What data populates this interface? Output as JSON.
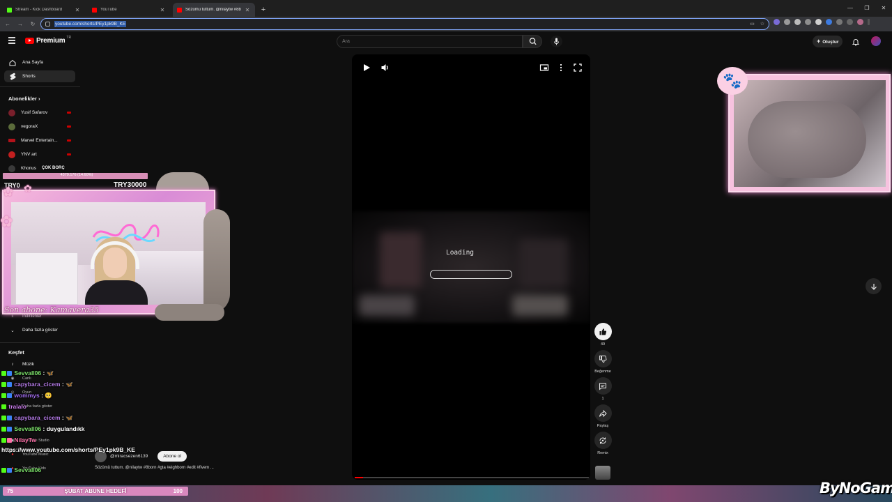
{
  "browser": {
    "tabs": [
      {
        "title": "Stream - Kick Dashboard",
        "favicon_color": "#53fc18"
      },
      {
        "title": "YouTube",
        "favicon_color": "#ff0000"
      },
      {
        "title": "Sözümü tuttum. @nilaytw #8b",
        "favicon_color": "#ff0000"
      }
    ],
    "url": "youtube.com/shorts/PEy1pk9B_KE"
  },
  "youtube": {
    "logo": "Premium",
    "region": "TR",
    "search_placeholder": "Ara",
    "create_label": "Oluştur",
    "sidebar": {
      "home": "Ana Sayfa",
      "shorts": "Shorts",
      "subscriptions_title": "Abonelikler",
      "subscriptions": [
        {
          "name": "Yusif Safarov",
          "color": "#7a1f2b"
        },
        {
          "name": "vegoraX",
          "color": "#5b6b3a"
        },
        {
          "name": "Marvel Entertain...",
          "color": "#b3121a"
        },
        {
          "name": "YNV art",
          "color": "#c21f1f"
        },
        {
          "name": "Khonus",
          "color": "#3a3a3a"
        }
      ],
      "downloads": "İndirilenler",
      "show_more": "Daha fazla göster",
      "explore_title": "Keşfet",
      "explore_items": [
        "Müzik",
        "Canlı",
        "Oyun",
        "Daha fazla göster"
      ],
      "studio": "YouTube Studio",
      "music": "YouTube Music",
      "kids": "YouTube Kids"
    },
    "player": {
      "loading": "Loading"
    },
    "actions": {
      "likes": "49",
      "dislike": "Beğenme",
      "comments": "1",
      "share": "Paylaş",
      "remix": "Remix"
    },
    "channel": {
      "handle": "@miracsezen6139",
      "subscribe": "Abone ol",
      "caption": "Sözümü tuttum. @nilaytw #8born #gta #eighborn #edit #fivem ..."
    }
  },
  "overlay": {
    "debt_label": "ÇOK BORÇ",
    "debt_value": "4379.176 (14.60%)",
    "goal_min": "TRY0",
    "goal_max": "TRY30000",
    "last_sub": "Son abone: Kamavera35",
    "chat": [
      {
        "user": "Sevvall06",
        "msg": ": 🦋",
        "color": "#7de36b"
      },
      {
        "user": "capybara_cicem",
        "msg": ": 🦋",
        "color": "#b57be8"
      },
      {
        "user": "wommys",
        "msg": ": 🥺",
        "color": "#a36ef0"
      },
      {
        "user": "tralalo",
        "msg": "",
        "color": "#c77ae8"
      },
      {
        "user": "capybara_cicem",
        "msg": ": 🦋",
        "color": "#b57be8"
      },
      {
        "user": "Sevvall06",
        "msg": ": duygulandıkk",
        "color": "#7de36b"
      },
      {
        "user": "NilayTw",
        "msg": "",
        "color": "#ff6fa8"
      }
    ],
    "chat_url": "https://www.youtube.com/shorts/PEy1pk9B_KE",
    "chat_last_user": "Sevvall06",
    "sub_goal_start": "75",
    "sub_goal_title": "ŞUBAT ABUNE HEDEFİ",
    "sub_goal_end": "100",
    "brand": "ByNoGam"
  }
}
